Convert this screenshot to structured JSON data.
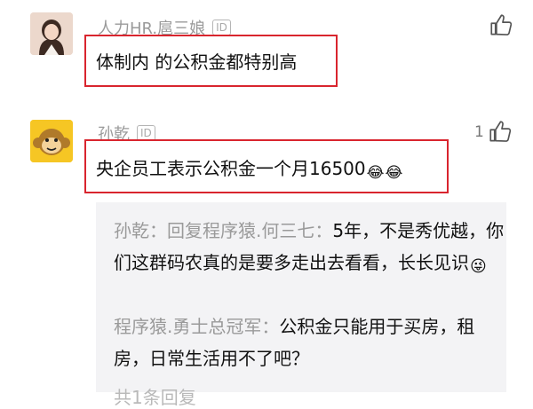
{
  "comments": [
    {
      "username": "人力HR.扈三娘",
      "badge": "ID",
      "text": "体制内 的公积金都特别高"
    },
    {
      "username": "孙乾",
      "badge": "ID",
      "like_count": "1",
      "text": "央企员工表示公积金一个月16500",
      "emoji": [
        "😂",
        "😂"
      ],
      "replies": [
        {
          "prefix": "孙乾：回复程序猿.何三七：",
          "text": "5年，不是秀优越，你们这群码农真的是要多走出去看看，长长见识",
          "emoji": "😜"
        },
        {
          "prefix": "程序猿.勇士总冠军：",
          "text": "公积金只能用于买房，租房，日常生活用不了吧？"
        }
      ],
      "more_reply_hint": "共1条回复"
    }
  ],
  "icons": {
    "like": "thumbs-up-icon",
    "avatar1": "woman-avatar-icon",
    "avatar2": "monkey-avatar-icon"
  },
  "colors": {
    "highlight_border": "#d9252e",
    "username": "#9a9a9a",
    "reply_bg": "#f3f3f5"
  }
}
